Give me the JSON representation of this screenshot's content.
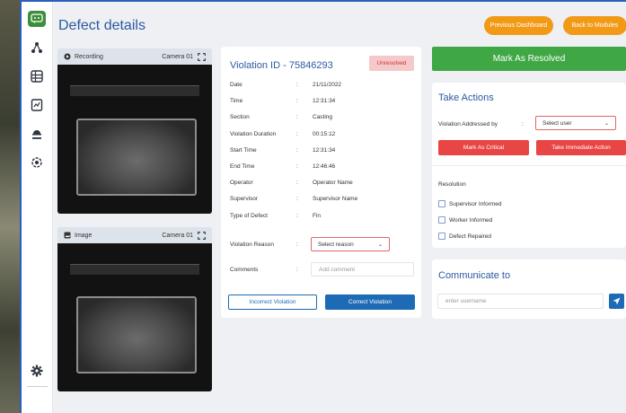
{
  "page_title": "Defect details",
  "header_buttons": {
    "previous": "Previous Dashboard",
    "back": "Back to Modules"
  },
  "recording": {
    "label": "Recording",
    "camera": "Camera 01"
  },
  "image": {
    "label": "Image",
    "camera": "Camera 01"
  },
  "violation": {
    "id_label": "Violation ID - 75846293",
    "status": "Unresolved",
    "rows": [
      {
        "k": "Date",
        "v": "21/11/2022"
      },
      {
        "k": "Time",
        "v": "12:31:34"
      },
      {
        "k": "Section",
        "v": "Casting"
      },
      {
        "k": "Violation Duration",
        "v": "00:15:12"
      },
      {
        "k": "Start Time",
        "v": "12:31:34"
      },
      {
        "k": "End Time",
        "v": "12:46:46"
      },
      {
        "k": "Operator",
        "v": "Operator Name"
      },
      {
        "k": "Supervisor",
        "v": "Supervisor Name"
      },
      {
        "k": "Type of Defect",
        "v": "Fin"
      }
    ],
    "colon": ":",
    "reason_label": "Violation Reason",
    "reason_value": "Select reason",
    "comments_label": "Comments",
    "comments_placeholder": "Add comment",
    "incorrect_btn": "Incorrect Violation",
    "correct_btn": "Correct Violation"
  },
  "mark_resolved": "Mark As Resolved",
  "actions": {
    "title": "Take Actions",
    "addressed_label": "Violation Addressed by",
    "addressed_value": "Select user",
    "critical_btn": "Mark As Critical",
    "immediate_btn": "Take Immediate Action",
    "resolution_label": "Resolution",
    "checks": [
      "Supervisor Informed",
      "Worker Informed",
      "Defect Repaired"
    ]
  },
  "communicate": {
    "title": "Communicate to",
    "placeholder": "enter username"
  },
  "colors": {
    "accent": "#2c5aa0",
    "orange": "#f29a16",
    "green": "#3fa845",
    "red": "#e84545",
    "blue": "#1d6bb5"
  }
}
